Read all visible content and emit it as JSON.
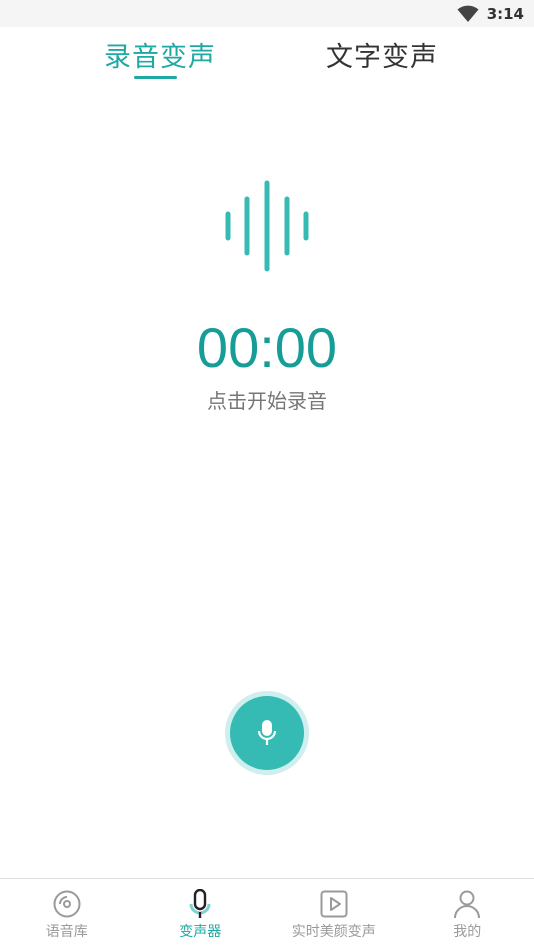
{
  "status": {
    "time": "3:14"
  },
  "tabs": [
    {
      "label": "录音变声",
      "active": true
    },
    {
      "label": "文字变声",
      "active": false
    }
  ],
  "recorder": {
    "timer": "00:00",
    "hint": "点击开始录音"
  },
  "nav": [
    {
      "label": "语音库",
      "icon": "disc-icon",
      "active": false
    },
    {
      "label": "变声器",
      "icon": "microphone-icon",
      "active": true
    },
    {
      "label": "实时美颜变声",
      "icon": "play-icon",
      "active": false
    },
    {
      "label": "我的",
      "icon": "person-icon",
      "active": false
    }
  ],
  "colors": {
    "accent": "#1fa9a3",
    "record_button": "#35bab4",
    "inactive": "#9a9a9a"
  }
}
